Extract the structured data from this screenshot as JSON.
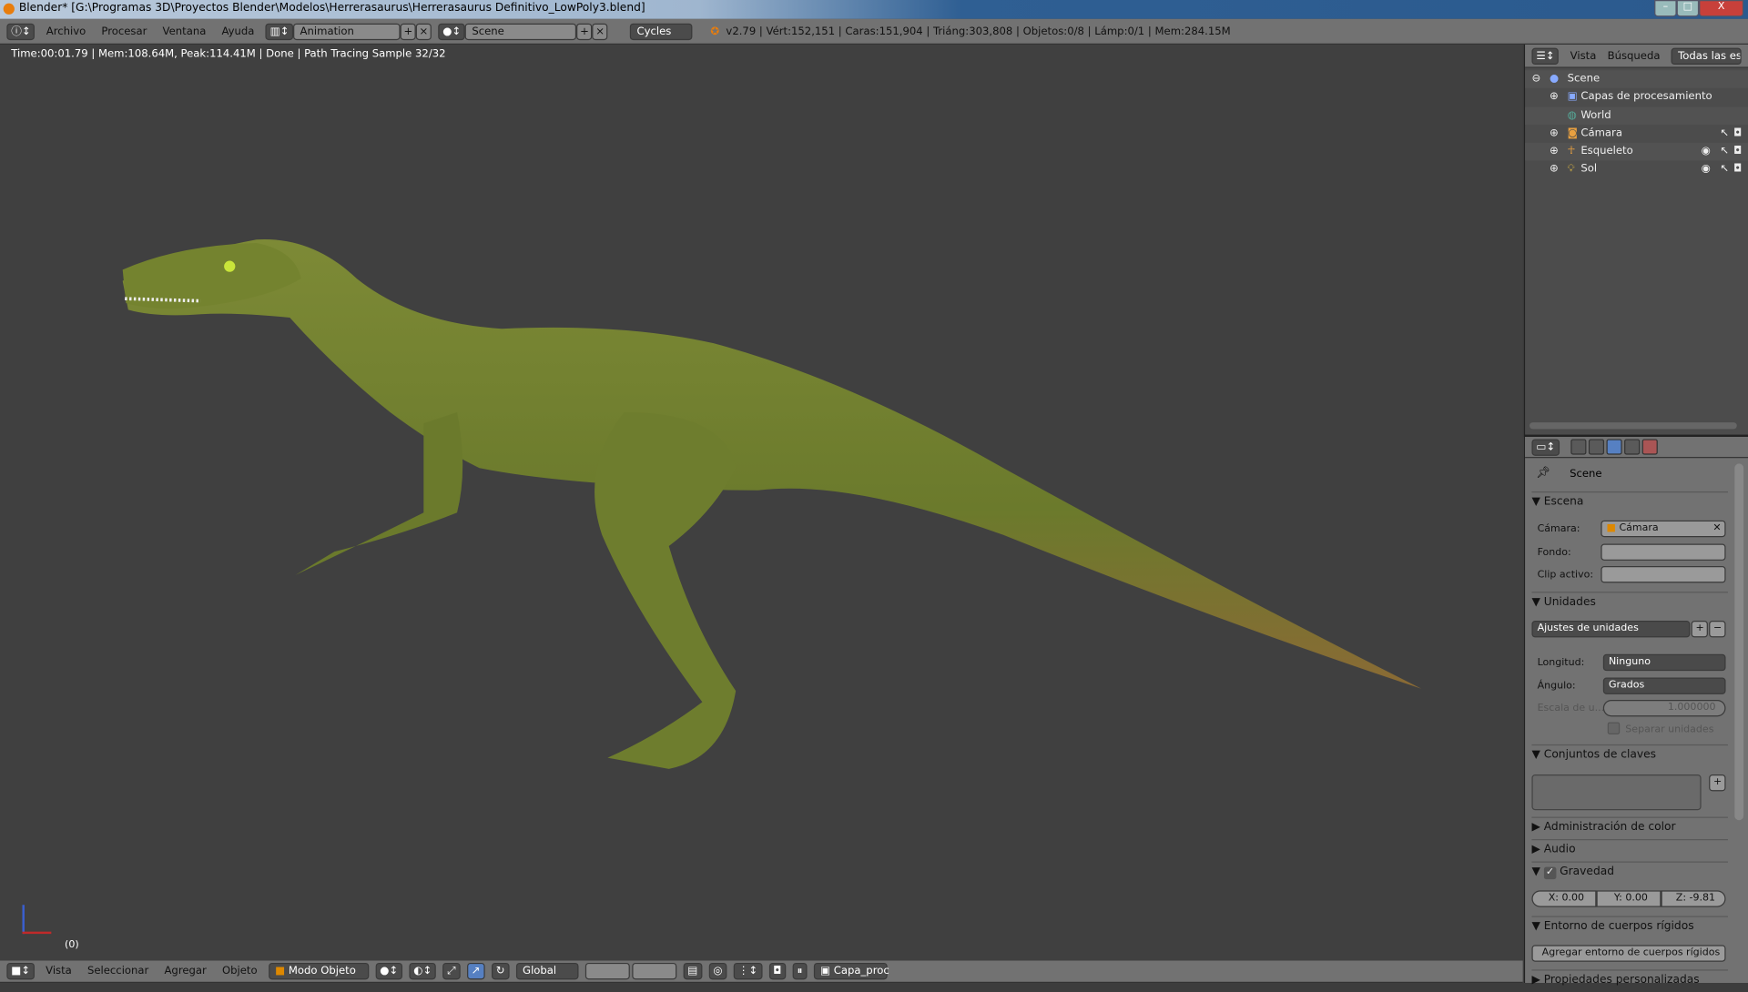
{
  "window": {
    "title": "Blender* [G:\\Programas 3D\\Proyectos Blender\\Modelos\\Herrerasaurus\\Herrerasaurus Definitivo_LowPoly3.blend]",
    "min": "–",
    "max": "□",
    "close": "X"
  },
  "info_header": {
    "menus": [
      "Archivo",
      "Procesar",
      "Ventana",
      "Ayuda"
    ],
    "screen_layout": "Animation",
    "scene": "Scene",
    "engine": "Cycles",
    "stats": "v2.79 | Vért:152,151 | Caras:151,904 | Triáng:303,808 | Objetos:0/8 | Lámp:0/1 | Mem:284.15M"
  },
  "viewport": {
    "render_info": "Time:00:01.79 | Mem:108.64M, Peak:114.41M | Done | Path Tracing Sample 32/32",
    "frame": "(0)",
    "colors": {
      "skin": "#6b7a2c",
      "belly": "#8a6a35"
    }
  },
  "outliner": {
    "tabs": [
      "Vista",
      "Búsqueda",
      "Todas las escenas"
    ],
    "items": [
      {
        "label": "Scene",
        "icon": "scene-icon"
      },
      {
        "label": "Capas de procesamiento",
        "icon": "render-layers-icon"
      },
      {
        "label": "World",
        "icon": "world-icon"
      },
      {
        "label": "Cámara",
        "icon": "camera-icon"
      },
      {
        "label": "Esqueleto",
        "icon": "armature-icon"
      },
      {
        "label": "Sol",
        "icon": "lamp-icon"
      }
    ]
  },
  "properties": {
    "context": "Scene",
    "escena": {
      "title": "Escena",
      "camera_label": "Cámara:",
      "camera_value": "Cámara",
      "fondo_label": "Fondo:",
      "clip_label": "Clip activo:"
    },
    "unidades": {
      "title": "Unidades",
      "preset": "Ajustes de unidades",
      "longitud_label": "Longitud:",
      "longitud": "Ninguno",
      "angulo_label": "Ángulo:",
      "angulo": "Grados",
      "escala_label": "Escala de u...",
      "escala": "1.000000",
      "separar": "Separar unidades"
    },
    "conjuntos": {
      "title": "Conjuntos de claves"
    },
    "color": "Administración de color",
    "audio": "Audio",
    "gravedad": {
      "title": "Gravedad",
      "x": "X:  0.00",
      "y": "Y:  0.00",
      "z": "Z:  -9.81"
    },
    "cuerpos": {
      "title": "Entorno de cuerpos rígidos",
      "button": "Agregar entorno de cuerpos rígidos"
    },
    "custom": "Propiedades personalizadas"
  },
  "bottom_header": {
    "menus": [
      "Vista",
      "Seleccionar",
      "Agregar",
      "Objeto"
    ],
    "mode": "Modo Objeto",
    "orientation": "Global",
    "render_layer": "Capa_proc"
  }
}
